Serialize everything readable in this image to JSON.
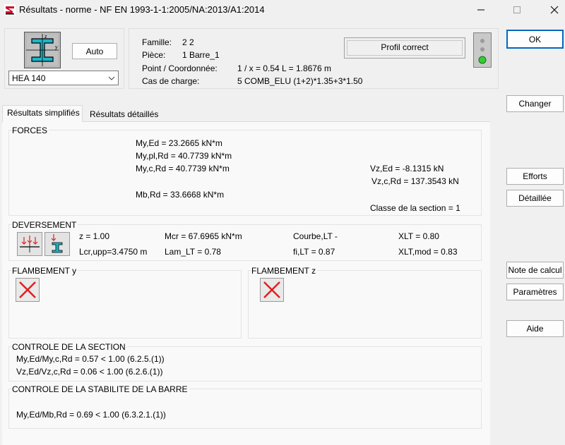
{
  "window": {
    "title": "Résultats - norme - NF EN 1993-1-1:2005/NA:2013/A1:2014"
  },
  "profile": {
    "auto_label": "Auto",
    "selected": "HEA 140"
  },
  "info": {
    "famille_label": "Famille:",
    "famille_value": "2  2",
    "piece_label": "Pièce:",
    "piece_value": "1  Barre_1",
    "point_label": "Point / Coordonnée:",
    "point_value": "1 / x = 0.54 L = 1.8676 m",
    "cas_label": "Cas de charge:",
    "cas_value": "5 COMB_ELU  (1+2)*1.35+3*1.50",
    "status": "Profil correct"
  },
  "tabs": [
    "Résultats simplifiés",
    "Résultats détaillés"
  ],
  "forces": {
    "title": "FORCES",
    "my_ed": "My,Ed = 23.2665 kN*m",
    "my_pl_rd": "My,pl,Rd = 40.7739 kN*m",
    "my_c_rd": "My,c,Rd = 40.7739 kN*m",
    "mb_rd": "Mb,Rd = 33.6668 kN*m",
    "vz_ed": "Vz,Ed = -8.1315 kN",
    "vz_c_rd": "Vz,c,Rd = 137.3543 kN",
    "classe": "Classe de la section = 1"
  },
  "deversement": {
    "title": "DEVERSEMENT",
    "z": "z = 1.00",
    "lcr": "Lcr,upp=3.4750 m",
    "mcr": "Mcr = 67.6965 kN*m",
    "lam": "Lam_LT = 0.78",
    "courbe": "Courbe,LT -",
    "fi": "fi,LT = 0.87",
    "xlt": "XLT = 0.80",
    "xlt_mod": "XLT,mod = 0.83"
  },
  "flambement": {
    "y_title": "FLAMBEMENT y",
    "z_title": "FLAMBEMENT z"
  },
  "controle_section": {
    "title": "CONTROLE DE LA SECTION",
    "line1": "My,Ed/My,c,Rd = 0.57 < 1.00   (6.2.5.(1))",
    "line2": "Vz,Ed/Vz,c,Rd = 0.06 < 1.00   (6.2.6.(1))"
  },
  "controle_stabilite": {
    "title": "CONTROLE DE LA STABILITE DE LA BARRE",
    "line1": "My,Ed/Mb,Rd = 0.69 < 1.00   (6.3.2.1.(1))"
  },
  "side_buttons": {
    "ok": "OK",
    "changer": "Changer",
    "efforts": "Efforts",
    "detaillee": "Détaillée",
    "note": "Note de calcul",
    "parametres": "Paramètres",
    "aide": "Aide"
  },
  "colors": {
    "accent": "#0067c0",
    "icon_cyan": "#1fb5c8",
    "light_green": "#33cc33",
    "cross_red": "#e02020"
  }
}
